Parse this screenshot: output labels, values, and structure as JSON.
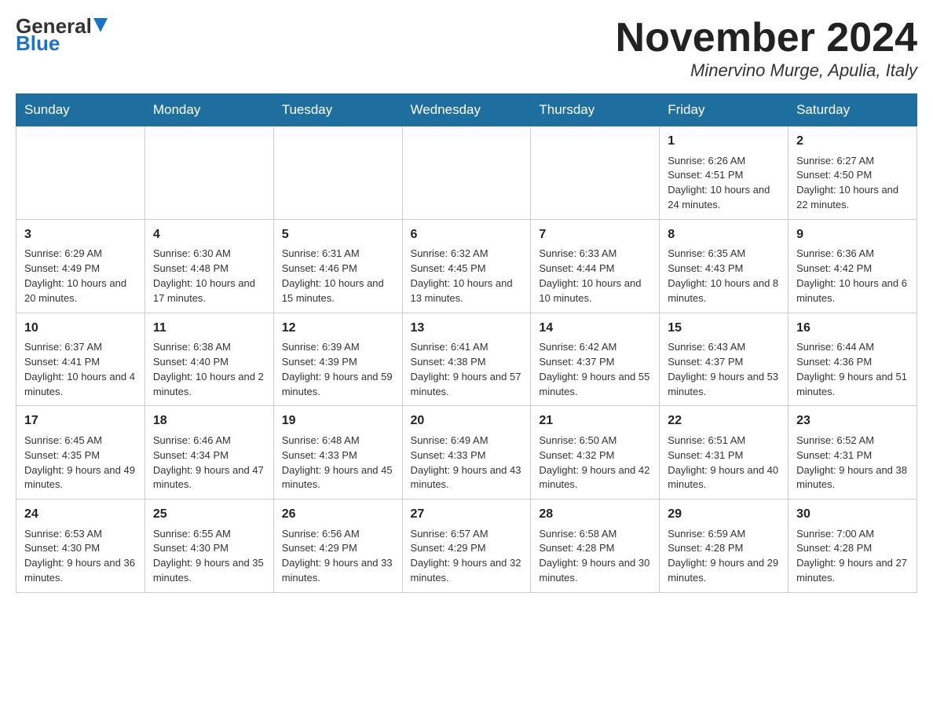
{
  "header": {
    "logo": {
      "line1": "General",
      "line2": "Blue"
    },
    "title": "November 2024",
    "location": "Minervino Murge, Apulia, Italy"
  },
  "weekdays": [
    "Sunday",
    "Monday",
    "Tuesday",
    "Wednesday",
    "Thursday",
    "Friday",
    "Saturday"
  ],
  "weeks": [
    [
      {
        "day": "",
        "info": ""
      },
      {
        "day": "",
        "info": ""
      },
      {
        "day": "",
        "info": ""
      },
      {
        "day": "",
        "info": ""
      },
      {
        "day": "",
        "info": ""
      },
      {
        "day": "1",
        "info": "Sunrise: 6:26 AM\nSunset: 4:51 PM\nDaylight: 10 hours and 24 minutes."
      },
      {
        "day": "2",
        "info": "Sunrise: 6:27 AM\nSunset: 4:50 PM\nDaylight: 10 hours and 22 minutes."
      }
    ],
    [
      {
        "day": "3",
        "info": "Sunrise: 6:29 AM\nSunset: 4:49 PM\nDaylight: 10 hours and 20 minutes."
      },
      {
        "day": "4",
        "info": "Sunrise: 6:30 AM\nSunset: 4:48 PM\nDaylight: 10 hours and 17 minutes."
      },
      {
        "day": "5",
        "info": "Sunrise: 6:31 AM\nSunset: 4:46 PM\nDaylight: 10 hours and 15 minutes."
      },
      {
        "day": "6",
        "info": "Sunrise: 6:32 AM\nSunset: 4:45 PM\nDaylight: 10 hours and 13 minutes."
      },
      {
        "day": "7",
        "info": "Sunrise: 6:33 AM\nSunset: 4:44 PM\nDaylight: 10 hours and 10 minutes."
      },
      {
        "day": "8",
        "info": "Sunrise: 6:35 AM\nSunset: 4:43 PM\nDaylight: 10 hours and 8 minutes."
      },
      {
        "day": "9",
        "info": "Sunrise: 6:36 AM\nSunset: 4:42 PM\nDaylight: 10 hours and 6 minutes."
      }
    ],
    [
      {
        "day": "10",
        "info": "Sunrise: 6:37 AM\nSunset: 4:41 PM\nDaylight: 10 hours and 4 minutes."
      },
      {
        "day": "11",
        "info": "Sunrise: 6:38 AM\nSunset: 4:40 PM\nDaylight: 10 hours and 2 minutes."
      },
      {
        "day": "12",
        "info": "Sunrise: 6:39 AM\nSunset: 4:39 PM\nDaylight: 9 hours and 59 minutes."
      },
      {
        "day": "13",
        "info": "Sunrise: 6:41 AM\nSunset: 4:38 PM\nDaylight: 9 hours and 57 minutes."
      },
      {
        "day": "14",
        "info": "Sunrise: 6:42 AM\nSunset: 4:37 PM\nDaylight: 9 hours and 55 minutes."
      },
      {
        "day": "15",
        "info": "Sunrise: 6:43 AM\nSunset: 4:37 PM\nDaylight: 9 hours and 53 minutes."
      },
      {
        "day": "16",
        "info": "Sunrise: 6:44 AM\nSunset: 4:36 PM\nDaylight: 9 hours and 51 minutes."
      }
    ],
    [
      {
        "day": "17",
        "info": "Sunrise: 6:45 AM\nSunset: 4:35 PM\nDaylight: 9 hours and 49 minutes."
      },
      {
        "day": "18",
        "info": "Sunrise: 6:46 AM\nSunset: 4:34 PM\nDaylight: 9 hours and 47 minutes."
      },
      {
        "day": "19",
        "info": "Sunrise: 6:48 AM\nSunset: 4:33 PM\nDaylight: 9 hours and 45 minutes."
      },
      {
        "day": "20",
        "info": "Sunrise: 6:49 AM\nSunset: 4:33 PM\nDaylight: 9 hours and 43 minutes."
      },
      {
        "day": "21",
        "info": "Sunrise: 6:50 AM\nSunset: 4:32 PM\nDaylight: 9 hours and 42 minutes."
      },
      {
        "day": "22",
        "info": "Sunrise: 6:51 AM\nSunset: 4:31 PM\nDaylight: 9 hours and 40 minutes."
      },
      {
        "day": "23",
        "info": "Sunrise: 6:52 AM\nSunset: 4:31 PM\nDaylight: 9 hours and 38 minutes."
      }
    ],
    [
      {
        "day": "24",
        "info": "Sunrise: 6:53 AM\nSunset: 4:30 PM\nDaylight: 9 hours and 36 minutes."
      },
      {
        "day": "25",
        "info": "Sunrise: 6:55 AM\nSunset: 4:30 PM\nDaylight: 9 hours and 35 minutes."
      },
      {
        "day": "26",
        "info": "Sunrise: 6:56 AM\nSunset: 4:29 PM\nDaylight: 9 hours and 33 minutes."
      },
      {
        "day": "27",
        "info": "Sunrise: 6:57 AM\nSunset: 4:29 PM\nDaylight: 9 hours and 32 minutes."
      },
      {
        "day": "28",
        "info": "Sunrise: 6:58 AM\nSunset: 4:28 PM\nDaylight: 9 hours and 30 minutes."
      },
      {
        "day": "29",
        "info": "Sunrise: 6:59 AM\nSunset: 4:28 PM\nDaylight: 9 hours and 29 minutes."
      },
      {
        "day": "30",
        "info": "Sunrise: 7:00 AM\nSunset: 4:28 PM\nDaylight: 9 hours and 27 minutes."
      }
    ]
  ]
}
